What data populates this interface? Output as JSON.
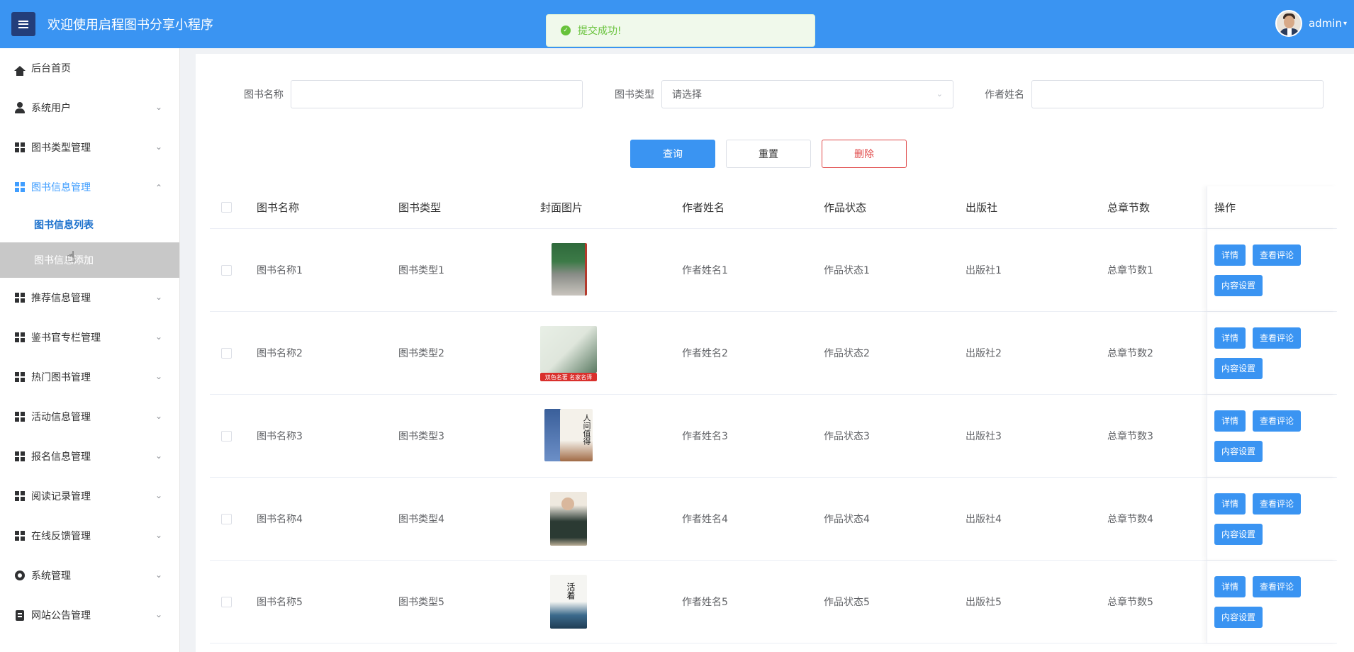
{
  "header": {
    "title": "欢迎使用启程图书分享小程序",
    "username": "admin",
    "bg_color": "#3a94f2",
    "menu_icon": "hamburger-icon"
  },
  "toast": {
    "message": "提交成功!",
    "type": "success"
  },
  "sidebar": {
    "items": [
      {
        "label": "后台首页",
        "icon": "home-icon"
      },
      {
        "label": "系统用户",
        "icon": "user-icon"
      },
      {
        "label": "图书类型管理",
        "icon": "grid-icon"
      },
      {
        "label": "图书信息管理",
        "icon": "grid-icon",
        "expanded": true
      },
      {
        "label": "推荐信息管理",
        "icon": "grid-icon"
      },
      {
        "label": "鉴书官专栏管理",
        "icon": "grid-icon"
      },
      {
        "label": "热门图书管理",
        "icon": "grid-icon"
      },
      {
        "label": "活动信息管理",
        "icon": "grid-icon"
      },
      {
        "label": "报名信息管理",
        "icon": "grid-icon"
      },
      {
        "label": "阅读记录管理",
        "icon": "grid-icon"
      },
      {
        "label": "在线反馈管理",
        "icon": "grid-icon"
      },
      {
        "label": "系统管理",
        "icon": "gear-icon"
      },
      {
        "label": "网站公告管理",
        "icon": "document-icon"
      }
    ],
    "subitems": [
      {
        "label": "图书信息列表"
      },
      {
        "label": "图书信息添加"
      }
    ]
  },
  "filters": {
    "name_label": "图书名称",
    "name_value": "",
    "type_label": "图书类型",
    "type_placeholder": "请选择",
    "author_label": "作者姓名",
    "author_value": ""
  },
  "actions": {
    "query": "查询",
    "reset": "重置",
    "delete": "删除"
  },
  "table": {
    "headers": [
      "图书名称",
      "图书类型",
      "封面图片",
      "作者姓名",
      "作品状态",
      "出版社",
      "总章节数",
      "操作"
    ],
    "rows": [
      {
        "name": "图书名称1",
        "type": "图书类型1",
        "author": "作者姓名1",
        "status": "作品状态1",
        "publisher": "出版社1",
        "chapters": "总章节数1"
      },
      {
        "name": "图书名称2",
        "type": "图书类型2",
        "author": "作者姓名2",
        "status": "作品状态2",
        "publisher": "出版社2",
        "chapters": "总章节数2",
        "cover_text": "双色名著  名家名译"
      },
      {
        "name": "图书名称3",
        "type": "图书类型3",
        "author": "作者姓名3",
        "status": "作品状态3",
        "publisher": "出版社3",
        "chapters": "总章节数3",
        "cover_text": "人间值得"
      },
      {
        "name": "图书名称4",
        "type": "图书类型4",
        "author": "作者姓名4",
        "status": "作品状态4",
        "publisher": "出版社4",
        "chapters": "总章节数4"
      },
      {
        "name": "图书名称5",
        "type": "图书类型5",
        "author": "作者姓名5",
        "status": "作品状态5",
        "publisher": "出版社5",
        "chapters": "总章节数5",
        "cover_text": "活着"
      }
    ],
    "row_buttons": {
      "detail": "详情",
      "comments": "查看评论",
      "content": "内容设置"
    }
  }
}
